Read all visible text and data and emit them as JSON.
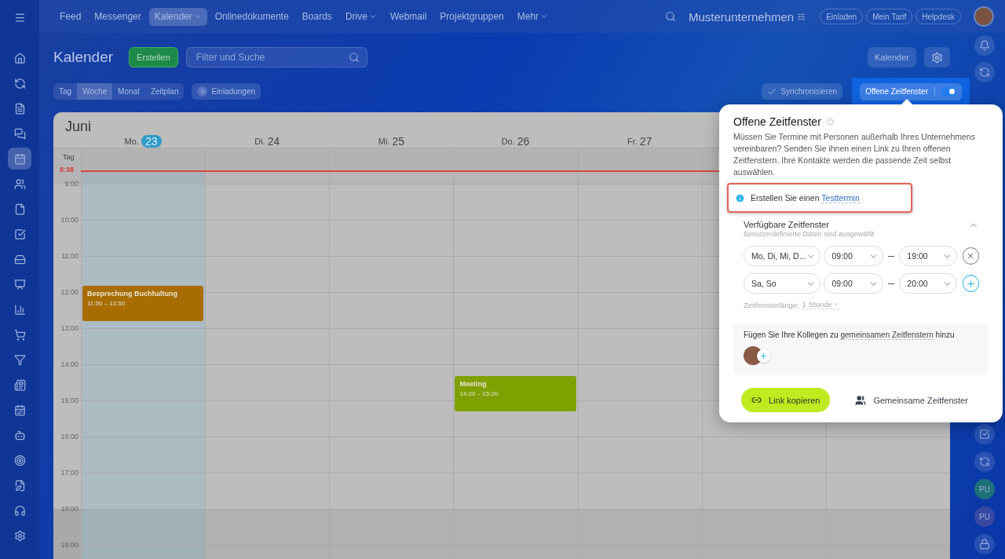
{
  "top_nav": {
    "items": [
      {
        "label": "Feed",
        "selected": false,
        "has_menu": false
      },
      {
        "label": "Messenger",
        "selected": false,
        "has_menu": false
      },
      {
        "label": "Kalender",
        "selected": true,
        "has_menu": true
      },
      {
        "label": "Onlinedokumente",
        "selected": false,
        "has_menu": false
      },
      {
        "label": "Boards",
        "selected": false,
        "has_menu": false
      },
      {
        "label": "Drive",
        "selected": false,
        "has_menu": true
      },
      {
        "label": "Webmail",
        "selected": false,
        "has_menu": false
      },
      {
        "label": "Projektgruppen",
        "selected": false,
        "has_menu": false
      },
      {
        "label": "Mehr",
        "selected": false,
        "has_menu": true
      }
    ],
    "company": "Musterunternehmen",
    "buttons": [
      "Einladen",
      "Mein Tarif",
      "Helpdesk"
    ]
  },
  "sidebar": {
    "items": [
      {
        "selected": false
      },
      {
        "selected": false
      },
      {
        "selected": false
      },
      {
        "selected": false
      },
      {
        "selected": true
      },
      {
        "selected": false
      },
      {
        "selected": false
      },
      {
        "selected": false
      },
      {
        "selected": false
      },
      {
        "selected": false
      },
      {
        "selected": false
      },
      {
        "selected": false
      },
      {
        "selected": false
      },
      {
        "selected": false
      },
      {
        "selected": false
      },
      {
        "selected": false
      },
      {
        "selected": false
      },
      {
        "selected": false
      },
      {
        "selected": false
      },
      {
        "selected": false
      }
    ]
  },
  "page": {
    "title": "Kalender",
    "create_button": "Erstellen",
    "search": {
      "placeholder": "Filter und Suche"
    },
    "calendar_button": "Kalender"
  },
  "views": [
    {
      "label": "Tag",
      "selected": false
    },
    {
      "label": "Woche",
      "selected": true
    },
    {
      "label": "Monat",
      "selected": false
    },
    {
      "label": "Zeitplan",
      "selected": false
    }
  ],
  "invitations": {
    "count": "0",
    "label": "Einladungen"
  },
  "sync_button": "Synchronisieren",
  "open_slots_toggle": {
    "label": "Offene Zeitfenster",
    "on": true
  },
  "calendar": {
    "month": "Juni",
    "allday_label": "Tag",
    "now": "8:38",
    "days": [
      {
        "weekday": "Mo.",
        "date": "23",
        "today": true,
        "events": [
          {
            "title": "Besprechung Buchhaltung",
            "time": "11:50 – 12:50",
            "color": "#a86d00"
          }
        ]
      },
      {
        "weekday": "Di.",
        "date": "24",
        "today": false
      },
      {
        "weekday": "Mi.",
        "date": "25",
        "today": false
      },
      {
        "weekday": "Do.",
        "date": "26",
        "today": false,
        "events": [
          {
            "title": "Meeting",
            "time": "14:20 – 15:20",
            "color": "#7ea100"
          }
        ]
      },
      {
        "weekday": "Fr.",
        "date": "27",
        "today": false
      }
    ],
    "hours": [
      {
        "label": "9:00",
        "off_hours": false
      },
      {
        "label": "10:00",
        "off_hours": false
      },
      {
        "label": "11:00",
        "off_hours": false
      },
      {
        "label": "12:00",
        "off_hours": false
      },
      {
        "label": "13:00",
        "off_hours": false
      },
      {
        "label": "14:00",
        "off_hours": false
      },
      {
        "label": "15:00",
        "off_hours": false
      },
      {
        "label": "16:00",
        "off_hours": false
      },
      {
        "label": "17:00",
        "off_hours": false
      },
      {
        "label": "18:00",
        "off_hours": true
      },
      {
        "label": "19:00",
        "off_hours": true
      }
    ]
  },
  "rail": {
    "top": [
      {
        "kind": "icon"
      },
      {
        "kind": "icon"
      }
    ],
    "bottom": [
      {
        "kind": "icon"
      },
      {
        "kind": "icon"
      },
      {
        "kind": "initials",
        "text": "PU",
        "color": "#1d6f78"
      },
      {
        "kind": "initials",
        "text": "PU",
        "color": "#3848a0"
      },
      {
        "kind": "icon"
      }
    ]
  },
  "popup": {
    "title": "Offene Zeitfenster",
    "description": "Müssen Sie Termine mit Personen außerhalb Ihres Unternehmens vereinbaren? Senden Sie ihnen einen Link zu Ihren offenen Zeitfenstern. Ihre Kontakte werden die passende Zeit selbst auswählen.",
    "hint": {
      "text": "Erstellen Sie einen",
      "link": "Testtermin",
      "highlighted": true
    },
    "slots_title": "Verfügbare Zeitfenster",
    "slots_subtitle": "Benutzerdefinierte Daten sind ausgewählt",
    "expanded": true,
    "slots": [
      {
        "days": "Mo, Di, Mi, D...",
        "from": "09:00",
        "to": "19:00",
        "kind": "remove"
      },
      {
        "days": "Sa, So",
        "from": "09:00",
        "to": "20:00",
        "kind": "add"
      }
    ],
    "length_label": "Zeitfensterlänge:",
    "length_value": "1 Stunde",
    "colleagues": {
      "before": "Fügen Sie Ihre Kollegen zu",
      "link": "gemeinsamen Zeitfenstern",
      "after": "hinzu"
    },
    "copy_button": "Link kopieren",
    "shared_button": "Gemeinsame Zeitfenster"
  }
}
